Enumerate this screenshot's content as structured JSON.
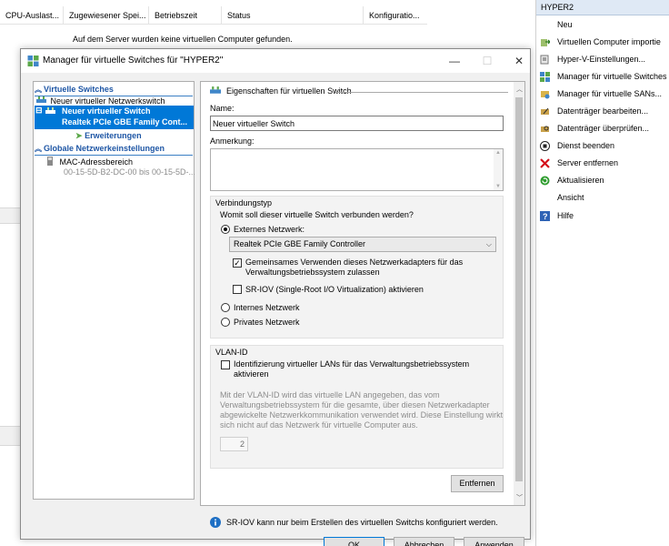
{
  "background": {
    "columns": [
      "CPU-Auslast...",
      "Zugewiesener Spei...",
      "Betriebszeit",
      "Status",
      "Konfiguratio..."
    ],
    "empty_message": "Auf dem Server wurden keine virtuellen Computer gefunden."
  },
  "actions": {
    "header": "HYPER2",
    "items": [
      {
        "label": "Neu",
        "icon": "none"
      },
      {
        "label": "Virtuellen Computer importie",
        "icon": "import-icon"
      },
      {
        "label": "Hyper-V-Einstellungen...",
        "icon": "settings-icon"
      },
      {
        "label": "Manager für virtuelle Switches",
        "icon": "switch-manager-icon"
      },
      {
        "label": "Manager für virtuelle SANs...",
        "icon": "san-manager-icon"
      },
      {
        "label": "Datenträger bearbeiten...",
        "icon": "edit-disk-icon"
      },
      {
        "label": "Datenträger überprüfen...",
        "icon": "inspect-disk-icon"
      },
      {
        "label": "Dienst beenden",
        "icon": "stop-icon"
      },
      {
        "label": "Server entfernen",
        "icon": "remove-icon"
      },
      {
        "label": "Aktualisieren",
        "icon": "refresh-icon"
      },
      {
        "label": "Ansicht",
        "icon": "none"
      },
      {
        "label": "Hilfe",
        "icon": "help-icon"
      }
    ]
  },
  "dialog": {
    "title": "Manager für virtuelle Switches für \"HYPER2\"",
    "tree": {
      "section_switches": "Virtuelle Switches",
      "new_network_switch": "Neuer virtueller Netzwerkswitch",
      "selected_switch_name": "Neuer virtueller Switch",
      "selected_switch_adapter": "Realtek PCIe GBE Family Cont...",
      "extensions": "Erweiterungen",
      "section_global": "Globale Netzwerkeinstellungen",
      "mac_range": "MAC-Adressbereich",
      "mac_range_value": "00-15-5D-B2-DC-00 bis 00-15-5D-..."
    },
    "panel": {
      "header": "Eigenschaften für virtuellen Switch",
      "name_label": "Name:",
      "name_value": "Neuer virtueller Switch",
      "notes_label": "Anmerkung:",
      "conn_group": "Verbindungstyp",
      "conn_question": "Womit soll dieser virtuelle Switch verbunden werden?",
      "external": "Externes Netzwerk:",
      "adapter": "Realtek PCIe GBE Family Controller",
      "share_adapter": "Gemeinsames Verwenden dieses Netzwerkadapters für das Verwaltungsbetriebssystem zulassen",
      "share_adapter_l1": "Gemeinsames Verwenden dieses Netzwerkadapters für das",
      "share_adapter_l2": "Verwaltungsbetriebssystem zulassen",
      "sriov": "SR-IOV (Single-Root I/O Virtualization) aktivieren",
      "internal": "Internes Netzwerk",
      "private": "Privates Netzwerk",
      "vlan_group": "VLAN-ID",
      "vlan_check_l1": "Identifizierung virtueller LANs für das Verwaltungsbetriebssystem",
      "vlan_check_l2": "aktivieren",
      "vlan_info_l1": "Mit der VLAN-ID wird das virtuelle LAN angegeben, das vom",
      "vlan_info_l2": "Verwaltungsbetriebssystem für die gesamte, über diesen Netzwerkadapter",
      "vlan_info_l3": "abgewickelte Netzwerkkommunikation verwendet wird. Diese Einstellung wirkt",
      "vlan_info_l4": "sich nicht auf das Netzwerk für virtuelle Computer aus.",
      "vlan_value": "2",
      "remove_button": "Entfernen",
      "info_text": "SR-IOV kann nur beim Erstellen des virtuellen Switchs konfiguriert werden. Ein"
    },
    "buttons": {
      "ok": "OK",
      "cancel": "Abbrechen",
      "apply": "Anwenden"
    }
  }
}
